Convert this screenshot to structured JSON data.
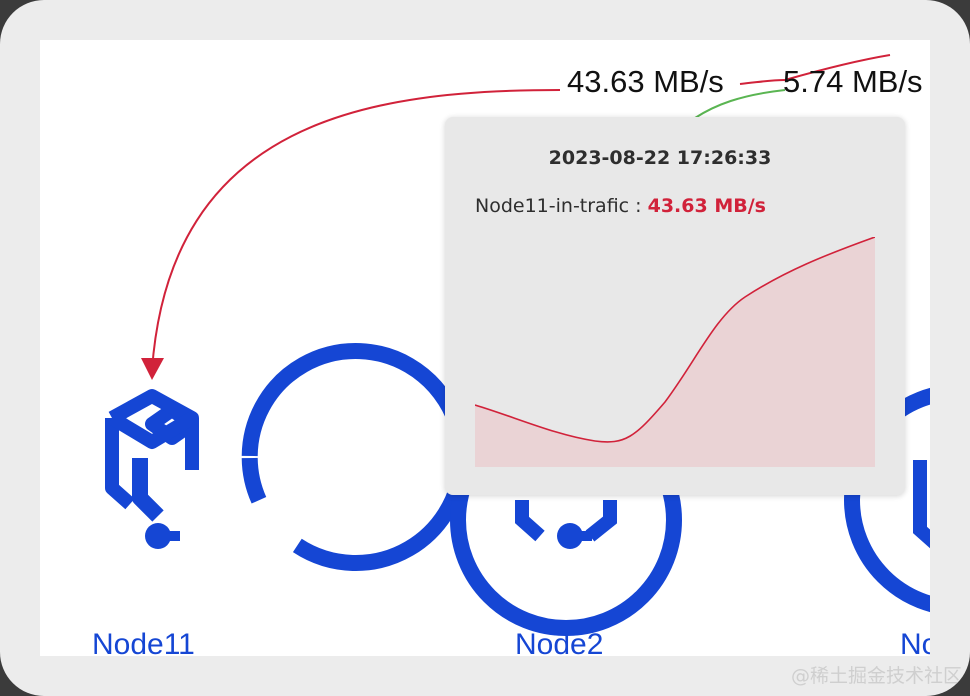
{
  "edges": {
    "edge1_rate": "43.63 MB/s",
    "edge2_rate": "5.74 MB/s"
  },
  "nodes": [
    "Node11",
    "Node2",
    "No"
  ],
  "tooltip": {
    "timestamp": "2023-08-22 17:26:33",
    "series_label": "Node11-in-trafic : ",
    "series_value": "43.63 MB/s",
    "value_color": "#d1223a"
  },
  "colors": {
    "node_blue": "#1546d4",
    "edge_red": "#d1223a",
    "edge_green": "#5ab552",
    "spark_fill": "#ead3d5"
  },
  "watermark": "@稀土掘金技术社区"
}
